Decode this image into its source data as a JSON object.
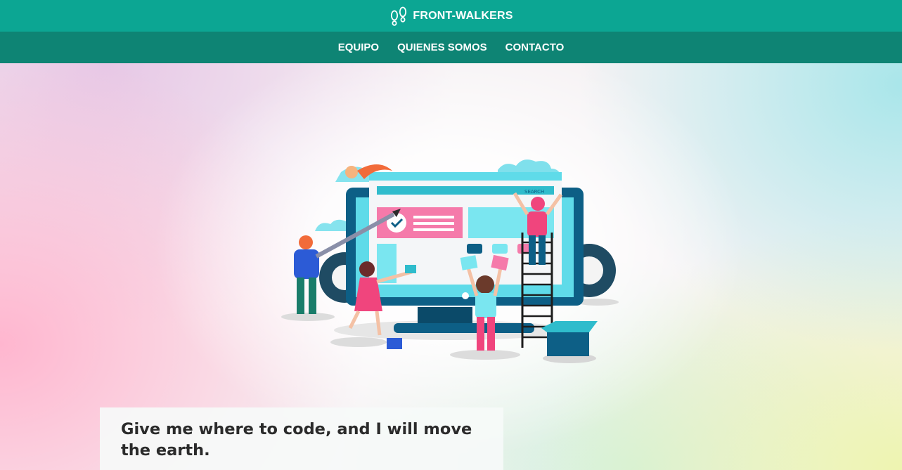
{
  "header": {
    "brand": "FRONT-WALKERS",
    "logo_icon": "footprints-icon",
    "color": "#0ca693"
  },
  "nav": {
    "color": "#0e8474",
    "items": [
      {
        "label": "EQUIPO"
      },
      {
        "label": "QUIENES SOMOS"
      },
      {
        "label": "CONTACTO"
      }
    ]
  },
  "hero": {
    "illustration": "team-building-website-illustration",
    "search_label": "SEARCH",
    "quote": "Give me where to code, and I will move the earth."
  }
}
